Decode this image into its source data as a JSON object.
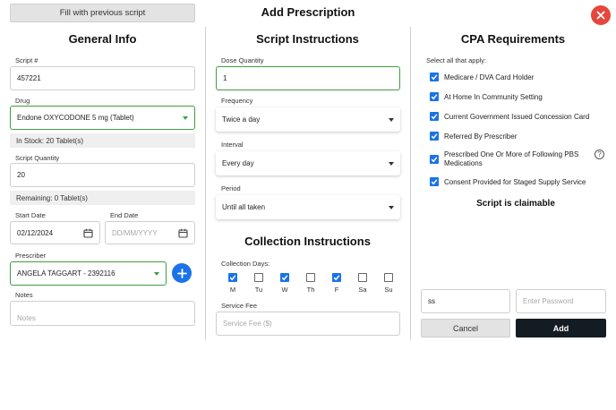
{
  "header": {
    "fill_previous_label": "Fill with previous script",
    "title": "Add Prescription",
    "close_icon": "close-icon"
  },
  "general": {
    "title": "General Info",
    "script_no_label": "Script #",
    "script_no_value": "457221",
    "drug_label": "Drug",
    "drug_value": "Endone OXYCODONE 5 mg (Tablet)",
    "in_stock": "In Stock: 20 Tablet(s)",
    "qty_label": "Script Quantity",
    "qty_value": "20",
    "remaining": "Remaining: 0 Tablet(s)",
    "start_label": "Start Date",
    "start_value": "02/12/2024",
    "end_label": "End Date",
    "end_placeholder": "DD/MM/YYYY",
    "prescriber_label": "Prescriber",
    "prescriber_value": "ANGELA TAGGART - 2392116",
    "notes_label": "Notes",
    "notes_placeholder": "Notes"
  },
  "script": {
    "title": "Script Instructions",
    "dose_label": "Dose Quantity",
    "dose_value": "1",
    "freq_label": "Frequency",
    "freq_value": "Twice a day",
    "interval_label": "Interval",
    "interval_value": "Every day",
    "period_label": "Period",
    "period_value": "Until all taken"
  },
  "collection": {
    "title": "Collection Instructions",
    "days_label": "Collection Days:",
    "days": [
      {
        "label": "M",
        "checked": true
      },
      {
        "label": "Tu",
        "checked": false
      },
      {
        "label": "W",
        "checked": true
      },
      {
        "label": "Th",
        "checked": false
      },
      {
        "label": "F",
        "checked": true
      },
      {
        "label": "Sa",
        "checked": false
      },
      {
        "label": "Su",
        "checked": false
      }
    ],
    "fee_label": "Service Fee",
    "fee_placeholder": "Service Fee ($)"
  },
  "cpa": {
    "title": "CPA Requirements",
    "select_all": "Select all that apply:",
    "items": [
      {
        "label": "Medicare / DVA Card Holder",
        "checked": true
      },
      {
        "label": "At Home In Community Setting",
        "checked": true
      },
      {
        "label": "Current Government Issued Concession Card",
        "checked": true
      },
      {
        "label": "Referred By Prescriber",
        "checked": true
      },
      {
        "label": "Prescribed One Or More of Following PBS",
        "label2": "Medications",
        "checked": true
      },
      {
        "label": "Consent Provided for Staged Supply Service",
        "checked": true
      }
    ],
    "claimable": "Script is claimable",
    "username_value": "ss",
    "password_placeholder": "Enter Password",
    "cancel_label": "Cancel",
    "add_label": "Add"
  }
}
